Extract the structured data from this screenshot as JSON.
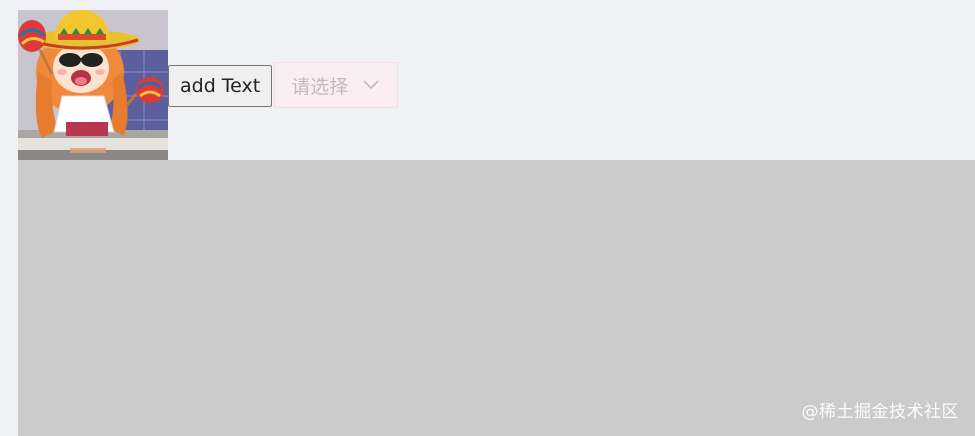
{
  "toolbar": {
    "avatar_alt": "anime girl with sombrero and maracas",
    "add_button_label": "add Text",
    "select": {
      "placeholder": "请选择",
      "icon": "chevron-down-icon"
    }
  },
  "canvas": {
    "background": "#cbcbcb"
  },
  "watermark": {
    "text": "@稀土掘金技术社区"
  },
  "colors": {
    "page_background": "#f0f1f5",
    "select_background": "#fbeef3",
    "select_border": "#f4dde3",
    "placeholder_text": "#c9b7bd"
  }
}
